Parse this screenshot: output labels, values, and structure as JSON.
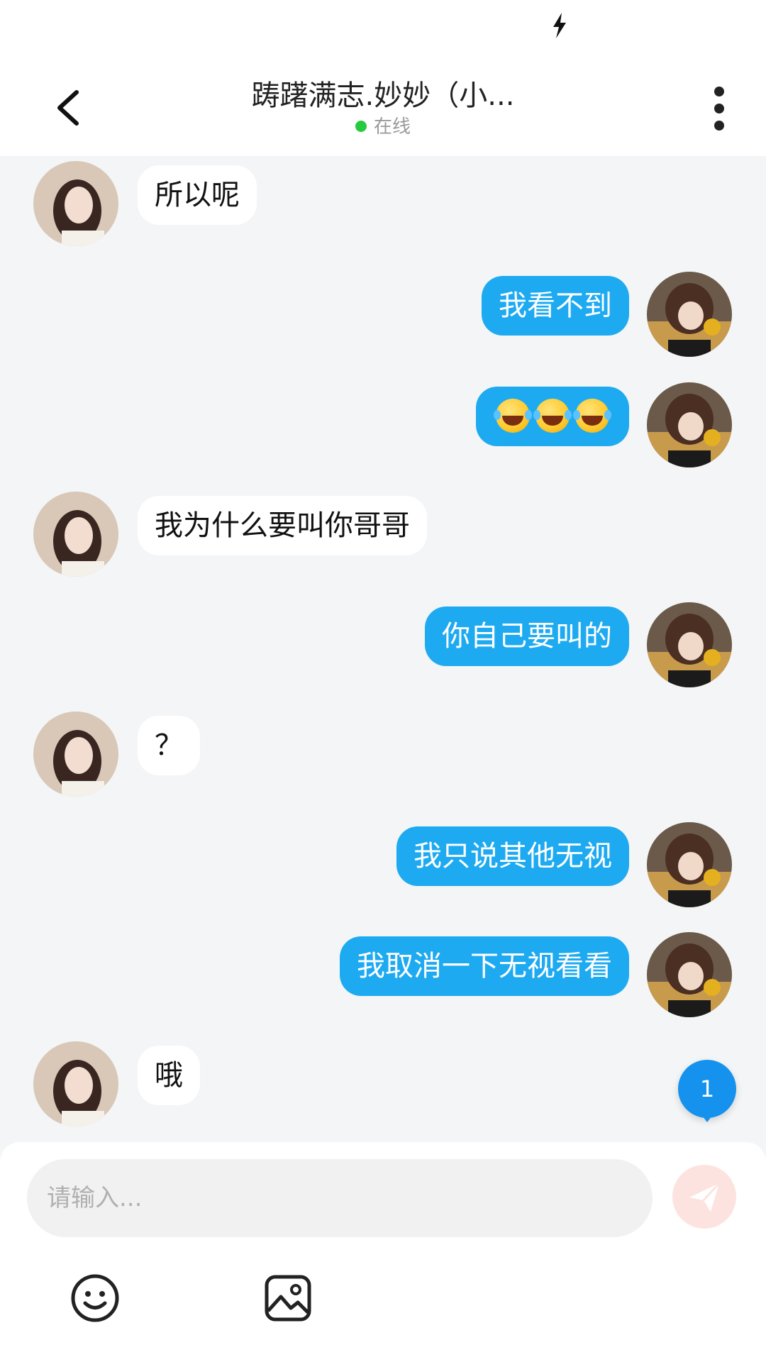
{
  "header": {
    "title": "踌躇满志.妙妙（小...",
    "status": "在线"
  },
  "messages": [
    {
      "side": "left",
      "text": "所以呢"
    },
    {
      "side": "right",
      "text": "我看不到"
    },
    {
      "side": "right",
      "emoji": [
        "laugh-cry-emoji",
        "laugh-cry-emoji",
        "laugh-cry-emoji"
      ]
    },
    {
      "side": "left",
      "text": "我为什么要叫你哥哥"
    },
    {
      "side": "right",
      "text": "你自己要叫的"
    },
    {
      "side": "left",
      "text": "？"
    },
    {
      "side": "right",
      "text": "我只说其他无视"
    },
    {
      "side": "right",
      "text": "我取消一下无视看看"
    },
    {
      "side": "left",
      "text": "哦"
    }
  ],
  "unread": {
    "count": "1"
  },
  "composer": {
    "placeholder": "请输入..."
  },
  "colors": {
    "outgoing_bubble": "#1eaaf1",
    "incoming_bubble": "#ffffff",
    "chat_background": "#f3f5f6",
    "online": "#27c93f",
    "badge": "#1592ee",
    "send_disabled": "#fde3df"
  },
  "icons": [
    "back-arrow-icon",
    "more-vertical-icon",
    "send-icon",
    "emoji-icon",
    "image-icon"
  ]
}
